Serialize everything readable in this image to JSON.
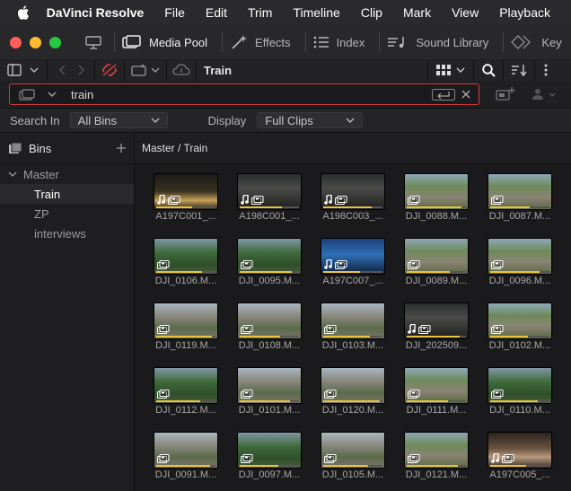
{
  "menubar": {
    "app_name": "DaVinci Resolve",
    "items": [
      "File",
      "Edit",
      "Trim",
      "Timeline",
      "Clip",
      "Mark",
      "View",
      "Playback"
    ]
  },
  "toolbar": {
    "media_pool": "Media Pool",
    "effects": "Effects",
    "index": "Index",
    "sound_library": "Sound Library",
    "keyframes": "Key"
  },
  "browser": {
    "title": "Train"
  },
  "search": {
    "value": "train"
  },
  "filters": {
    "search_in_label": "Search In",
    "search_in_value": "All Bins",
    "display_label": "Display",
    "display_value": "Full Clips"
  },
  "sidebar": {
    "header": "Bins",
    "master": "Master",
    "items": [
      "Train",
      "ZP",
      "interviews"
    ],
    "selected": "Train"
  },
  "main": {
    "breadcrumb": "Master / Train",
    "clips": [
      {
        "name": "A197C001_...",
        "audio": true,
        "scene": "night"
      },
      {
        "name": "A198C001_...",
        "audio": true,
        "scene": "dark"
      },
      {
        "name": "A198C003_...",
        "audio": true,
        "scene": "dark"
      },
      {
        "name": "DJI_0088.M...",
        "audio": false,
        "scene": "track"
      },
      {
        "name": "DJI_0087.M...",
        "audio": false,
        "scene": "track"
      },
      {
        "name": "DJI_0106.M...",
        "audio": false,
        "scene": "forest"
      },
      {
        "name": "DJI_0095.M...",
        "audio": false,
        "scene": "forest"
      },
      {
        "name": "A197C007_...",
        "audio": true,
        "scene": "blue"
      },
      {
        "name": "DJI_0089.M...",
        "audio": false,
        "scene": "track"
      },
      {
        "name": "DJI_0096.M...",
        "audio": false,
        "scene": "track"
      },
      {
        "name": "DJI_0119.M...",
        "audio": false,
        "scene": "town"
      },
      {
        "name": "DJI_0108.M...",
        "audio": false,
        "scene": "town"
      },
      {
        "name": "DJI_0103.M...",
        "audio": false,
        "scene": "town"
      },
      {
        "name": "DJI_202509...",
        "audio": true,
        "scene": "dark"
      },
      {
        "name": "DJI_0102.M...",
        "audio": false,
        "scene": "track"
      },
      {
        "name": "DJI_0112.M...",
        "audio": false,
        "scene": "forest"
      },
      {
        "name": "DJI_0101.M...",
        "audio": false,
        "scene": "town"
      },
      {
        "name": "DJI_0120.M...",
        "audio": false,
        "scene": "town"
      },
      {
        "name": "DJI_0111.M...",
        "audio": false,
        "scene": "track"
      },
      {
        "name": "DJI_0110.M...",
        "audio": false,
        "scene": "forest"
      },
      {
        "name": "DJI_0091.M...",
        "audio": false,
        "scene": "town"
      },
      {
        "name": "DJI_0097.M...",
        "audio": false,
        "scene": "forest"
      },
      {
        "name": "DJI_0105.M...",
        "audio": false,
        "scene": "town"
      },
      {
        "name": "DJI_0121.M...",
        "audio": false,
        "scene": "track"
      },
      {
        "name": "A197C005_...",
        "audio": true,
        "scene": "indoor"
      }
    ]
  },
  "colors": {
    "accent_red": "#d23b3b",
    "clip_bar": "#e8c33a",
    "traffic_red": "#fe5f57",
    "traffic_yellow": "#febc2e",
    "traffic_green": "#28c840"
  }
}
